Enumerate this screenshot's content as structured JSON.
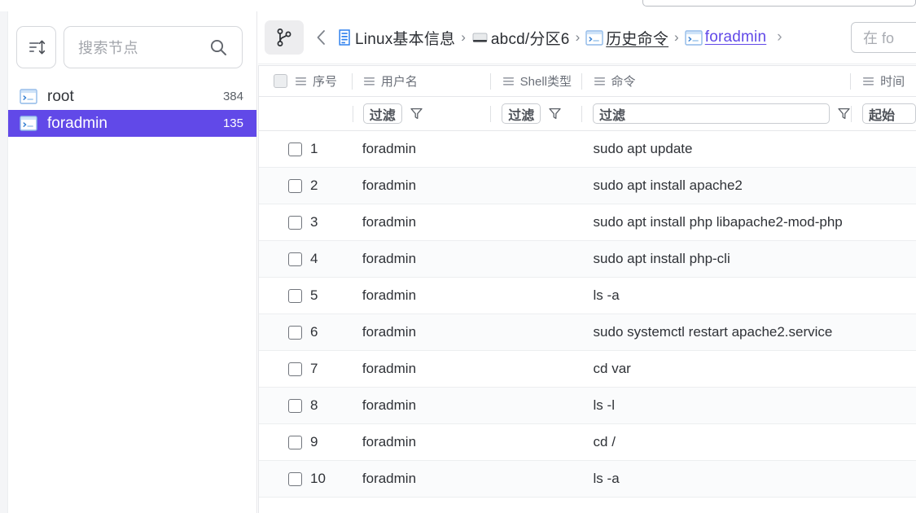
{
  "theme": {
    "accent": "#6149e8",
    "link": "#6149e8",
    "text": "#2f3237",
    "muted": "#6b7079",
    "row_alt": "#fafbfc",
    "border": "#e6e7ea",
    "icon_blue": "#2f80ed"
  },
  "sidebar": {
    "sort_button_label": "排序",
    "sort_icon": "sort-icon",
    "search": {
      "placeholder": "搜索节点",
      "value": "",
      "icon": "search-icon"
    },
    "items": [
      {
        "icon": "terminal-icon",
        "label": "root",
        "count": "384",
        "selected": false
      },
      {
        "icon": "terminal-icon",
        "label": "foradmin",
        "count": "135",
        "selected": true
      }
    ]
  },
  "breadcrumb": {
    "branch_button_icon": "git-branch-icon",
    "back_icon": "chevron-left-icon",
    "trailing_icon": "chevron-right-icon",
    "items": [
      {
        "icon": "document-list-icon",
        "label": "Linux基本信息",
        "style": "plain"
      },
      {
        "icon": "disk-icon",
        "label": "abcd/分区6",
        "style": "plain"
      },
      {
        "icon": "terminal-icon",
        "label": "历史命令",
        "style": "linked"
      },
      {
        "icon": "terminal-icon",
        "label": "foradmin",
        "style": "active"
      }
    ],
    "search": {
      "placeholder": "在 fo",
      "value": ""
    }
  },
  "table": {
    "select_all_checkbox": "select-all",
    "columns": [
      {
        "key": "index",
        "label": "序号",
        "grip": "grip-icon",
        "filter": null,
        "funnel": false
      },
      {
        "key": "username",
        "label": "用户名",
        "grip": "grip-icon",
        "filter": "过滤",
        "funnel": true
      },
      {
        "key": "shell",
        "label": "Shell类型",
        "grip": "grip-icon",
        "filter": "过滤",
        "funnel": true
      },
      {
        "key": "command",
        "label": "命令",
        "grip": "grip-icon",
        "filter": "过滤",
        "funnel": true
      },
      {
        "key": "time",
        "label": "时间",
        "grip": "grip-icon",
        "filter": "起始",
        "funnel": false
      }
    ],
    "rows": [
      {
        "index": "1",
        "username": "foradmin",
        "shell": "",
        "command": "sudo apt update",
        "time": ""
      },
      {
        "index": "2",
        "username": "foradmin",
        "shell": "",
        "command": "sudo apt install apache2",
        "time": ""
      },
      {
        "index": "3",
        "username": "foradmin",
        "shell": "",
        "command": "sudo apt install php libapache2-mod-php",
        "time": ""
      },
      {
        "index": "4",
        "username": "foradmin",
        "shell": "",
        "command": "sudo apt install php-cli",
        "time": ""
      },
      {
        "index": "5",
        "username": "foradmin",
        "shell": "",
        "command": "ls -a",
        "time": ""
      },
      {
        "index": "6",
        "username": "foradmin",
        "shell": "",
        "command": "sudo systemctl restart apache2.service",
        "time": ""
      },
      {
        "index": "7",
        "username": "foradmin",
        "shell": "",
        "command": "cd var",
        "time": ""
      },
      {
        "index": "8",
        "username": "foradmin",
        "shell": "",
        "command": "ls -l",
        "time": ""
      },
      {
        "index": "9",
        "username": "foradmin",
        "shell": "",
        "command": "cd /",
        "time": ""
      },
      {
        "index": "10",
        "username": "foradmin",
        "shell": "",
        "command": "ls -a",
        "time": ""
      }
    ]
  }
}
